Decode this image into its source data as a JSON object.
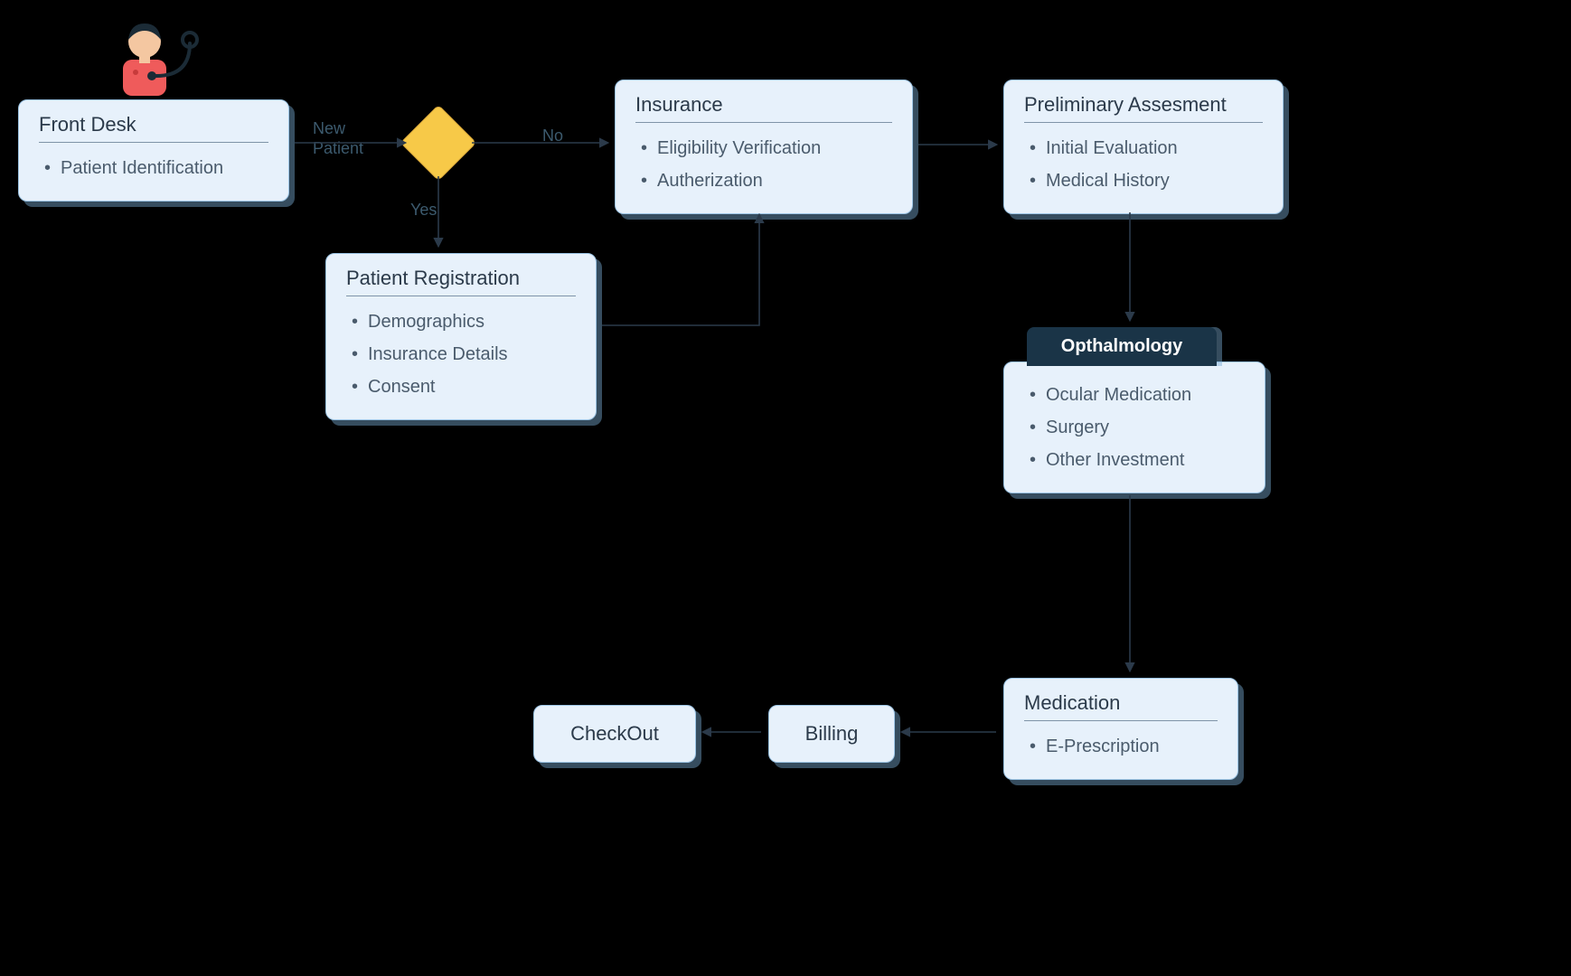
{
  "nodes": {
    "front_desk": {
      "title": "Front Desk",
      "items": [
        "Patient Identification"
      ]
    },
    "patient_registration": {
      "title": "Patient Registration",
      "items": [
        "Demographics",
        "Insurance Details",
        "Consent"
      ]
    },
    "insurance": {
      "title": "Insurance",
      "items": [
        "Eligibility Verification",
        "Autherization"
      ]
    },
    "preliminary": {
      "title": "Preliminary Assesment",
      "items": [
        "Initial Evaluation",
        "Medical History"
      ]
    },
    "ophthalmology": {
      "header": "Opthalmology",
      "items": [
        "Ocular Medication",
        "Surgery",
        "Other Investment"
      ]
    },
    "medication": {
      "title": "Medication",
      "items": [
        "E-Prescription"
      ]
    },
    "billing": {
      "label": "Billing"
    },
    "checkout": {
      "label": "CheckOut"
    }
  },
  "edges": {
    "new_patient": "New\nPatient",
    "yes": "Yes",
    "no": "No"
  },
  "icon": {
    "name": "doctor-icon"
  }
}
